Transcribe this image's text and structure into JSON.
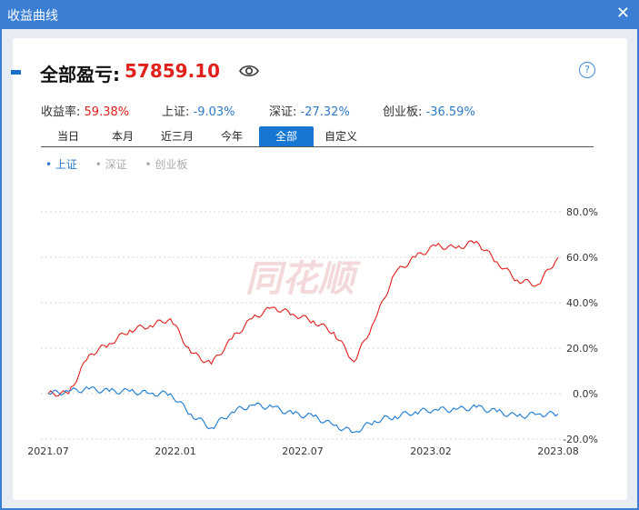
{
  "window": {
    "title": "收益曲线",
    "close_label": "✕"
  },
  "summary": {
    "label": "全部盈亏:",
    "value": "57859.10",
    "visibility_icon": "eye-icon",
    "help_icon": "?"
  },
  "stats": [
    {
      "label": "收益率:",
      "value": "59.38%",
      "color": "red"
    },
    {
      "label": "上证:",
      "value": "-9.03%",
      "color": "blue"
    },
    {
      "label": "深证:",
      "value": "-27.32%",
      "color": "blue"
    },
    {
      "label": "创业板:",
      "value": "-36.59%",
      "color": "blue"
    }
  ],
  "tabs": [
    {
      "label": "当日",
      "active": false
    },
    {
      "label": "本月",
      "active": false
    },
    {
      "label": "近三月",
      "active": false
    },
    {
      "label": "今年",
      "active": false
    },
    {
      "label": "全部",
      "active": true
    },
    {
      "label": "自定义",
      "active": false
    }
  ],
  "legend": [
    {
      "label": "上证",
      "active": true
    },
    {
      "label": "深证",
      "active": false
    },
    {
      "label": "创业板",
      "active": false
    }
  ],
  "watermark": "同花顺",
  "chart_data": {
    "type": "line",
    "x_ticks": [
      "2021.07",
      "2022.01",
      "2022.07",
      "2023.02",
      "2023.08"
    ],
    "y_ticks": [
      "80.0%",
      "60.0%",
      "40.0%",
      "20.0%",
      "0.0%",
      "-20.0%"
    ],
    "ylim": [
      -20,
      80
    ],
    "x": [
      "2021.07",
      "2021.08",
      "2021.09",
      "2021.10",
      "2021.11",
      "2021.12",
      "2022.01",
      "2022.02",
      "2022.03",
      "2022.04",
      "2022.05",
      "2022.06",
      "2022.07",
      "2022.08",
      "2022.09",
      "2022.10",
      "2022.11",
      "2022.12",
      "2023.01",
      "2023.02",
      "2023.03",
      "2023.04",
      "2023.05",
      "2023.06",
      "2023.07",
      "2023.08"
    ],
    "series": [
      {
        "color": "#e0201b",
        "values": [
          0,
          0,
          17,
          22,
          28,
          30,
          33,
          18,
          13,
          24,
          33,
          38,
          35,
          32,
          27,
          14,
          32,
          53,
          60,
          65,
          64,
          67,
          58,
          50,
          48,
          60
        ]
      },
      {
        "color": "#1a7ad0",
        "values": [
          0,
          1,
          2,
          1,
          1,
          0,
          0,
          -9,
          -15,
          -8,
          -5,
          -6,
          -9,
          -10,
          -14,
          -17,
          -12,
          -10,
          -8,
          -7,
          -7,
          -6,
          -8,
          -10,
          -9,
          -9
        ]
      }
    ]
  }
}
